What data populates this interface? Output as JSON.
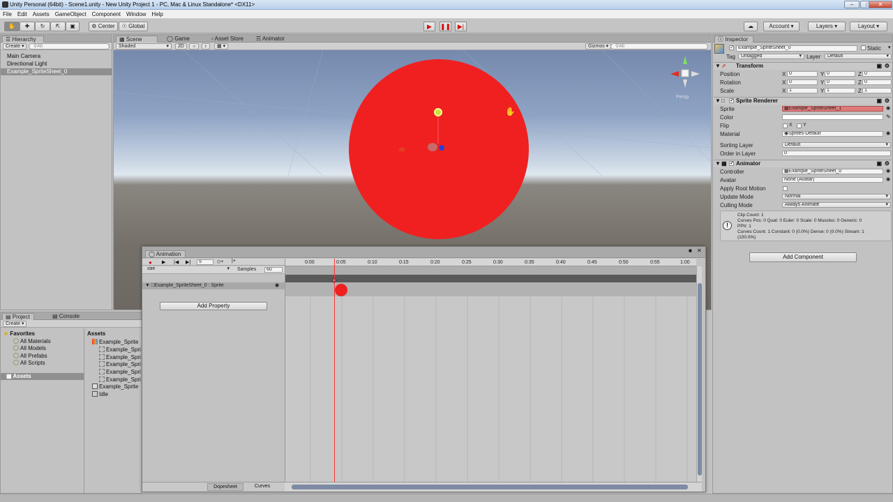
{
  "window": {
    "title": "Unity Personal (64bit) - Scene1.unity - New Unity Project 1 - PC, Mac & Linux Standalone* <DX11>"
  },
  "menu": [
    "File",
    "Edit",
    "Assets",
    "GameObject",
    "Component",
    "Window",
    "Help"
  ],
  "toolbar": {
    "center": "Center",
    "global": "Global",
    "account": "Account",
    "layers": "Layers",
    "layout": "Layout"
  },
  "hierarchy": {
    "tab": "Hierarchy",
    "create": "Create",
    "search": "All",
    "items": [
      "Main Camera",
      "Directional Light",
      "Example_SpriteSheet_0"
    ]
  },
  "scene": {
    "tabs": [
      "Scene",
      "Game",
      "Asset Store",
      "Animator"
    ],
    "shading": "Shaded",
    "mode2d": "2D",
    "gizmos": "Gizmos",
    "search": "All",
    "persp": "Persp"
  },
  "project": {
    "tabs": [
      "Project",
      "Console"
    ],
    "create": "Create",
    "favorites_title": "Favorites",
    "favorites": [
      "All Materials",
      "All Models",
      "All Prefabs",
      "All Scripts"
    ],
    "assets_root": "Assets",
    "assets_header": "Assets",
    "assets": [
      "Example_Sprite",
      "Example_Spri",
      "Example_Spri",
      "Example_Spri",
      "Example_Spri",
      "Example_Spri",
      "Example_Sprite",
      "Idle"
    ]
  },
  "animation": {
    "tab": "Animation",
    "frame": "5",
    "clip": "Idle",
    "samples_label": "Samples",
    "samples": "60",
    "property": "Example_SpriteSheet_0 : Sprite",
    "add_property": "Add Property",
    "ticks": [
      "0:00",
      "0:05",
      "0:10",
      "0:15",
      "0:20",
      "0:25",
      "0:30",
      "0:35",
      "0:40",
      "0:45",
      "0:50",
      "0:55",
      "1:00"
    ],
    "bottom_tabs": [
      "Dopesheet",
      "Curves"
    ]
  },
  "inspector": {
    "tab": "Inspector",
    "object_name": "Example_SpriteSheet_0",
    "static": "Static",
    "tag_label": "Tag",
    "tag": "Untagged",
    "layer_label": "Layer",
    "layer": "Default",
    "transform": {
      "title": "Transform",
      "rows": [
        {
          "label": "Position",
          "x": "0",
          "y": "0",
          "z": "0"
        },
        {
          "label": "Rotation",
          "x": "0",
          "y": "0",
          "z": "0"
        },
        {
          "label": "Scale",
          "x": "1",
          "y": "1",
          "z": "1"
        }
      ]
    },
    "sprite_renderer": {
      "title": "Sprite Renderer",
      "sprite_label": "Sprite",
      "sprite": "Example_SpriteSheet_1",
      "color_label": "Color",
      "flip_label": "Flip",
      "flip_x": "X",
      "flip_y": "Y",
      "material_label": "Material",
      "material": "Sprites-Default",
      "sorting_label": "Sorting Layer",
      "sorting": "Default",
      "order_label": "Order in Layer",
      "order": "0"
    },
    "animator": {
      "title": "Animator",
      "controller_label": "Controller",
      "controller": "Example_SpriteSheet_0",
      "avatar_label": "Avatar",
      "avatar": "None (Avatar)",
      "root_motion_label": "Apply Root Motion",
      "update_label": "Update Mode",
      "update": "Normal",
      "culling_label": "Culling Mode",
      "culling": "Always Animate",
      "info": [
        "Clip Count: 1",
        "Curves Pos: 0 Quat: 0 Euler: 0 Scale: 0 Muscles: 0 Generic: 0",
        "PPtr: 1",
        "Curves Count: 1 Constant: 0 (0.0%) Dense: 0 (0.0%) Stream: 1",
        "(100.0%)"
      ]
    },
    "add_component": "Add Component"
  },
  "colors": {
    "sprite": "#f02020",
    "record": "#d01010",
    "sprite_field": "#e07a7a"
  }
}
